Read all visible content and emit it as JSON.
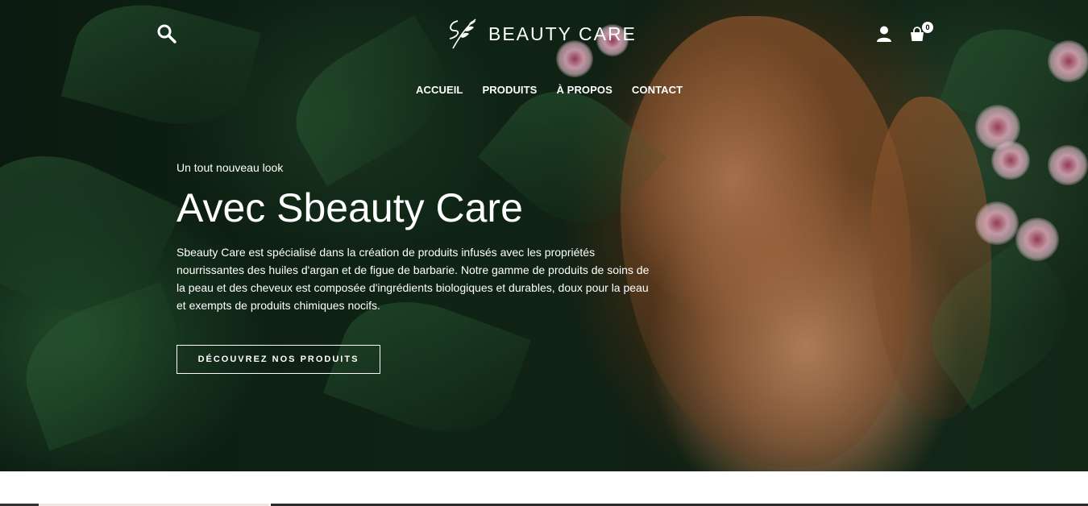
{
  "header": {
    "logo_text": "BEAUTY CARE",
    "cart_count": "0",
    "icons": [
      "search-icon",
      "user-icon",
      "cart-icon"
    ]
  },
  "nav": {
    "items": [
      {
        "label": "ACCUEIL"
      },
      {
        "label": "PRODUITS"
      },
      {
        "label": "À PROPOS"
      },
      {
        "label": "CONTACT"
      }
    ]
  },
  "hero": {
    "eyebrow": "Un tout nouveau look",
    "title": "Avec Sbeauty Care",
    "description": "Sbeauty Care est spécialisé dans la création de produits infusés avec les propriétés nourrissantes des huiles d'argan et de figue de barbarie. Notre gamme de produits de soins de la peau et des cheveux est composée d'ingrédients biologiques et durables, doux pour la peau et exempts de produits chimiques nocifs.",
    "cta_label": "DÉCOUVREZ NOS PRODUITS"
  },
  "colors": {
    "text": "#ffffff",
    "background_dark": "#0f2415",
    "accent": "#ffffff"
  }
}
